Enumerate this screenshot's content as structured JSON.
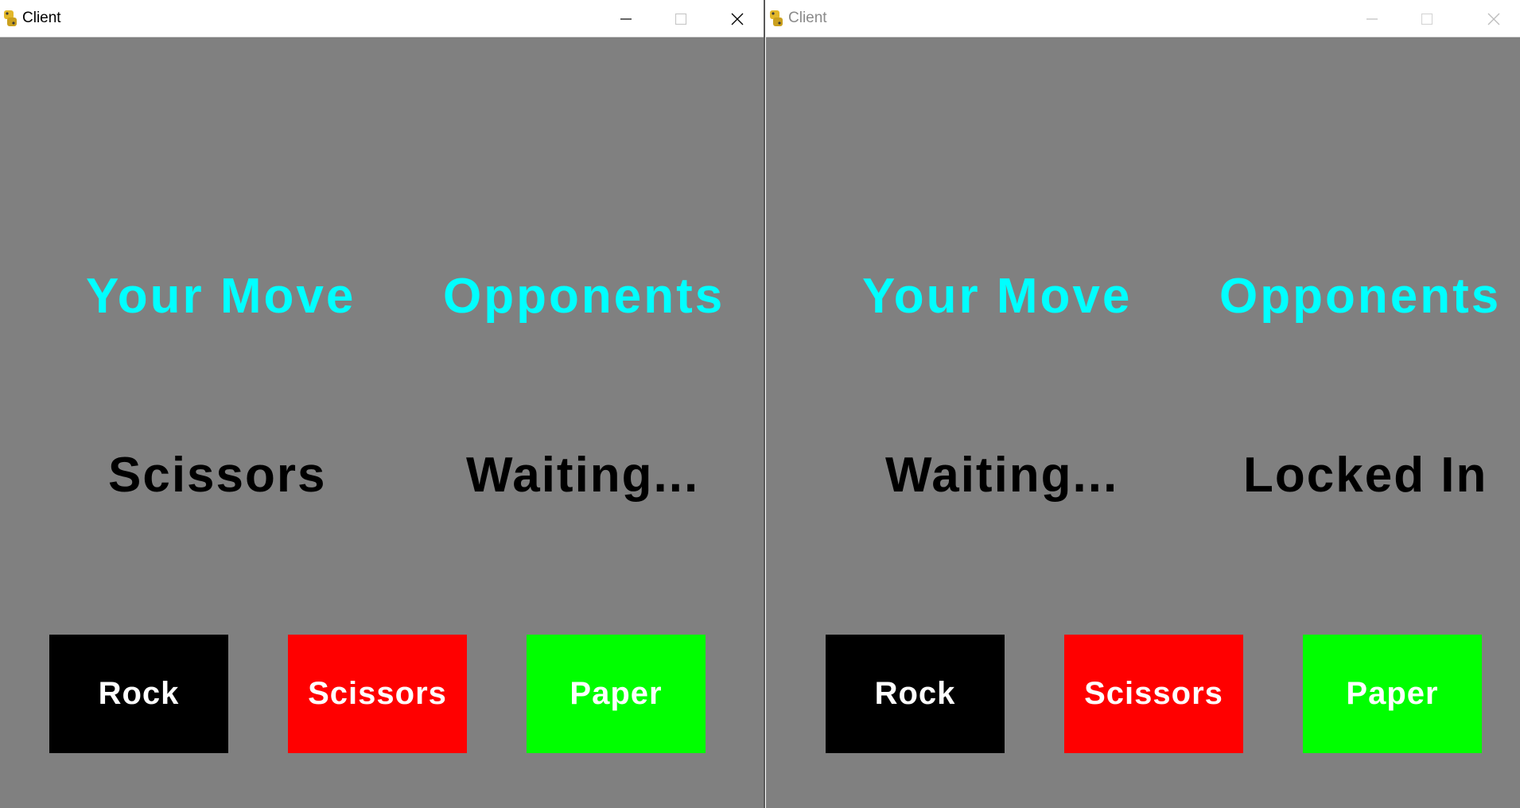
{
  "windows": [
    {
      "title": "Client",
      "your_move_label": "Your Move",
      "opponents_label": "Opponents",
      "your_status": "Scissors",
      "opponent_status": "Waiting...",
      "buttons": {
        "rock": "Rock",
        "scissors": "Scissors",
        "paper": "Paper"
      }
    },
    {
      "title": "Client",
      "your_move_label": "Your Move",
      "opponents_label": "Opponents",
      "your_status": "Waiting...",
      "opponent_status": "Locked In",
      "buttons": {
        "rock": "Rock",
        "scissors": "Scissors",
        "paper": "Paper"
      }
    }
  ],
  "colors": {
    "background": "#808080",
    "heading": "#00ffff",
    "status": "#000000",
    "rock_button": "#000000",
    "scissors_button": "#ff0000",
    "paper_button": "#00ff00",
    "button_text": "#ffffff"
  },
  "icons": [
    "python-app-icon",
    "minimize-icon",
    "maximize-icon",
    "close-icon"
  ]
}
